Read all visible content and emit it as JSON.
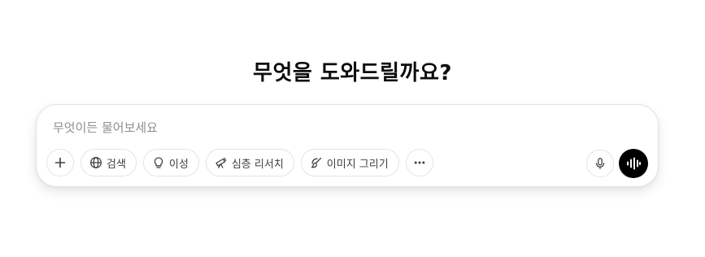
{
  "heading": "무엇을 도와드릴까요?",
  "composer": {
    "placeholder": "무엇이든 물어보세요",
    "value": ""
  },
  "tools": [
    {
      "label": "검색",
      "icon": "globe-icon"
    },
    {
      "label": "이성",
      "icon": "lightbulb-icon"
    },
    {
      "label": "심층 리서치",
      "icon": "telescope-icon"
    },
    {
      "label": "이미지 그리기",
      "icon": "paintbrush-icon"
    }
  ],
  "icons": {
    "add": "plus-icon",
    "more": "more-horizontal-icon",
    "dictate": "microphone-icon",
    "voice": "voice-waveform-icon"
  },
  "colors": {
    "text": "#0d0d0d",
    "placeholder": "#8f8f8f",
    "border": "#e3e3e3",
    "voice_button": "#000000"
  }
}
